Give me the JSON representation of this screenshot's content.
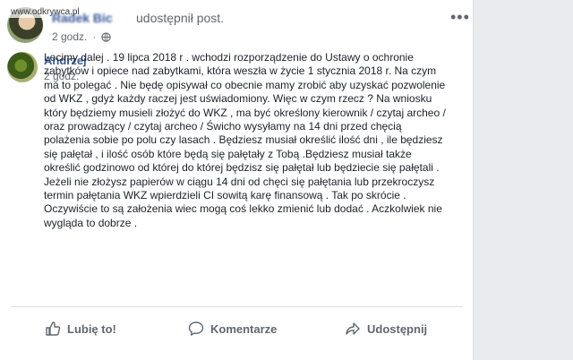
{
  "post": {
    "author": "Radek Bic",
    "action_text": "udostępnił post.",
    "time": "2 godz.",
    "watermark": "www.odkrywca.pl"
  },
  "shared": {
    "author": "Andrzej",
    "time": "2 godz.",
    "lines": [
      "Lecimy dalej . 19 lipca 2018 r . wchodzi rozporządzenie do Ustawy o ochronie",
      "zabytków i opiece nad zabytkami, która weszła w życie 1 stycznia 2018 r. Na czym",
      "ma to polegać . Nie będę opisywał co obecnie mamy zrobić aby uzyskać pozwolenie",
      "od WKZ , gdyż każdy raczej jest uświadomiony. Więc w czym rzecz ? Na wniosku",
      "który będziemy musieli złożyć do WKZ , ma być określony kierownik / czytaj archeo /",
      "oraz prowadzący / czytaj archeo / Świcho wysyłamy na 14 dni przed chęcią",
      "polażenia sobie po polu czy lasach . Będziesz musiał określić ilość dni , ile będziesz",
      "się pałętał , i ilość osób które będą się pałętały z Tobą .Będziesz musiał także",
      "określić godzinowo od której do której będzisz się pałętał lub będziecie się pałętali .",
      "Jeżeli nie złożysz papierów w ciągu 14 dni od chęci się pałętania lub przekroczysz",
      "termin pałętania WKZ wpierdzieli CI sowitą karę finansową . Tak po skrócie .",
      "Oczywiście to są założenia wiec mogą coś lekko zmienić lub dodać . Aczkolwiek nie",
      "wygląda to dobrze ."
    ]
  },
  "actions": {
    "like": "Lubię to!",
    "comment": "Komentarze",
    "share": "Udostępnij"
  },
  "icons": {
    "more": "more-options-icon",
    "privacy": "globe-icon",
    "like": "thumbs-up-icon",
    "comment": "speech-bubble-icon",
    "share": "share-arrow-icon"
  },
  "colors": {
    "link": "#365899",
    "secondary_text": "#606770",
    "background": "#e9ebee"
  }
}
